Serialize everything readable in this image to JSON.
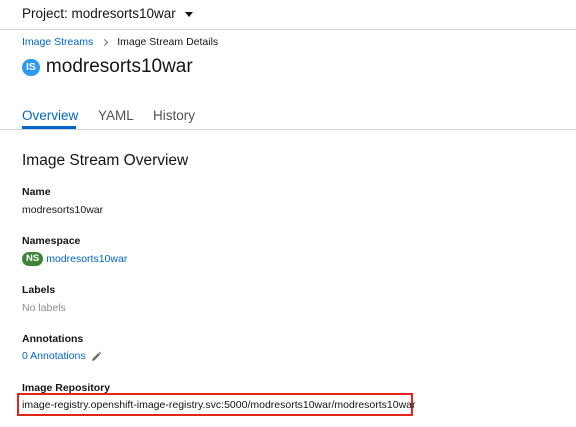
{
  "header": {
    "project_label": "Project: modresorts10war"
  },
  "breadcrumb": {
    "parent": "Image Streams",
    "current": "Image Stream Details"
  },
  "title": {
    "badge": "IS",
    "name": "modresorts10war"
  },
  "tabs": [
    {
      "label": "Overview",
      "active": true
    },
    {
      "label": "YAML",
      "active": false
    },
    {
      "label": "History",
      "active": false
    }
  ],
  "overview": {
    "heading": "Image Stream Overview",
    "name": {
      "label": "Name",
      "value": "modresorts10war"
    },
    "namespace": {
      "label": "Namespace",
      "badge": "NS",
      "value": "modresorts10war"
    },
    "labels": {
      "label": "Labels",
      "value": "No labels"
    },
    "annotations": {
      "label": "Annotations",
      "value": "0 Annotations"
    },
    "image_repository": {
      "label": "Image Repository",
      "value": "image-registry.openshift-image-registry.svc:5000/modresorts10war/modresorts10war"
    }
  },
  "colors": {
    "link": "#0066cc",
    "is_badge": "#2b9af3",
    "ns_badge": "#3e8635",
    "highlight_box": "#e3261b"
  },
  "icons": {
    "project_caret": "caret-down-icon",
    "breadcrumb_separator": "chevron-right-icon",
    "annotations_edit": "pencil-icon"
  }
}
